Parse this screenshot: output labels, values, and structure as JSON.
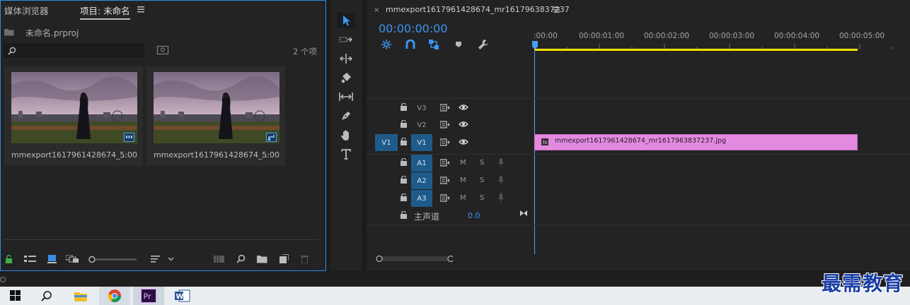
{
  "project_panel": {
    "tabs": [
      "媒体浏览器",
      "项目: 未命名"
    ],
    "menu_icon": "hamburger-icon",
    "project_file": "未命名.prproj",
    "search_placeholder": "",
    "item_count": "2 个项",
    "items": [
      {
        "name": "mmexport1617961428674_...",
        "duration": "5:00",
        "badge": "image-sequence-icon"
      },
      {
        "name": "mmexport1617961428674_...",
        "duration": "5:00",
        "badge": "image-link-icon"
      }
    ]
  },
  "tools": [
    "selection-tool",
    "track-select-tool",
    "ripple-edit-tool",
    "razor-tool",
    "slip-tool",
    "pen-tool",
    "hand-tool",
    "type-tool"
  ],
  "timeline": {
    "sequence_name": "mmexport1617961428674_mr1617963837237",
    "timecode": "00:00:00:00",
    "ruler_labels": [
      ":00:00",
      "00:00:01:00",
      "00:00:02:00",
      "00:00:03:00",
      "00:00:04:00",
      "00:00:05:00"
    ],
    "tracks": {
      "video": [
        {
          "name": "V3",
          "source": ""
        },
        {
          "name": "V2",
          "source": ""
        },
        {
          "name": "V1",
          "source": "V1"
        }
      ],
      "audio": [
        {
          "name": "A1",
          "m": "M",
          "s": "S"
        },
        {
          "name": "A2",
          "m": "M",
          "s": "S"
        },
        {
          "name": "A3",
          "m": "M",
          "s": "S"
        }
      ],
      "master_label": "主声道",
      "master_value": "0.0"
    },
    "clip": {
      "name": "mmexport1617961428674_mr1617963837237.jpg",
      "color": "#e38ae0"
    }
  },
  "colors": {
    "accent": "#2d8ceb",
    "playhead": "#4a9eff",
    "work_area": "#f0e000"
  },
  "watermark": "最需教育"
}
